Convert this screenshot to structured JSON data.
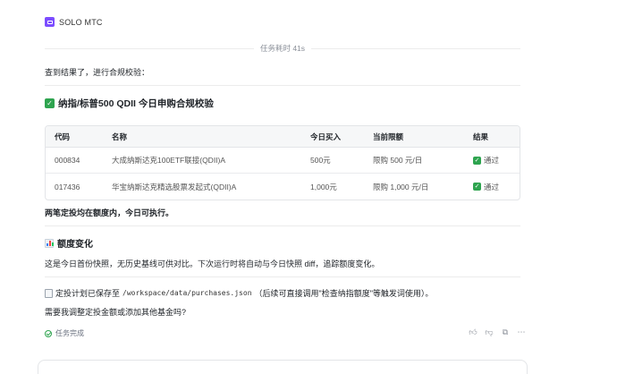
{
  "header": {
    "brand": "SOLO MTC",
    "logo_icon": "monitor-icon",
    "accent": "#7c4dff"
  },
  "task_time": "任务耗时 41s",
  "intro": "查到结果了，进行合规校验：",
  "section1": {
    "title": "纳指/标普500 QDII 今日申购合规校验",
    "icon": "check-icon"
  },
  "table": {
    "headers": [
      "代码",
      "名称",
      "今日买入",
      "当前限额",
      "结果"
    ],
    "rows": [
      {
        "code": "000834",
        "name": "大成纳斯达克100ETF联接(QDII)A",
        "buy": "500元",
        "limit": "限购 500 元/日",
        "result": "通过"
      },
      {
        "code": "017436",
        "name": "华宝纳斯达克精选股票发起式(QDII)A",
        "buy": "1,000元",
        "limit": "限购 1,000 元/日",
        "result": "通过"
      }
    ]
  },
  "summary": "两笔定投均在额度内，今日可执行。",
  "section2": {
    "title": "额度变化",
    "icon": "bar-chart-icon"
  },
  "section2_text": "这是今日首份快照，无历史基线可供对比。下次运行时将自动与今日快照 diff，追踪额度变化。",
  "saved": {
    "prefix": "定投计划已保存至",
    "path": "/workspace/data/purchases.json",
    "suffix": "（后续可直接调用\"检查纳指额度\"等触发词使用）。"
  },
  "question": "需要我调整定投金额或添加其他基金吗?",
  "status": "任务完成",
  "status_color": "#2ea44f"
}
